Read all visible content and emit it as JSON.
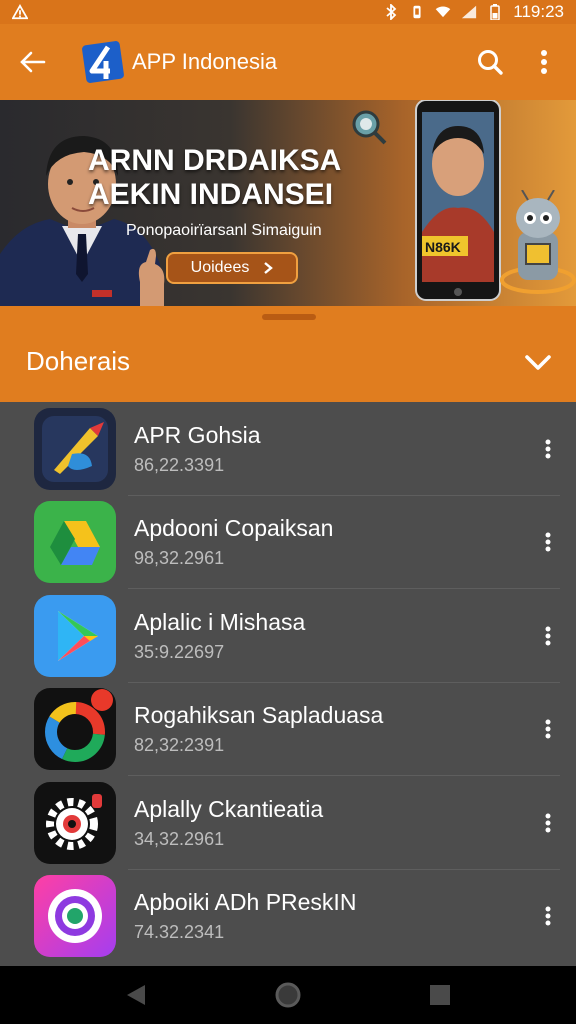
{
  "status_bar": {
    "time": "119:23"
  },
  "app_bar": {
    "title": "APP Indonesia"
  },
  "banner": {
    "headline_line1": "ARNN DRDAIKSA",
    "headline_line2": "AEKIN INDANSEI",
    "subtitle": "Ponopaoirïarsanl Simaiguin",
    "cta_label": "Uoidees",
    "phone_badge": "N86K"
  },
  "section": {
    "title": "Doherais"
  },
  "apps": [
    {
      "name": "APR Gohsia",
      "meta": "86,22.3391"
    },
    {
      "name": "Apdooni Copaiksan",
      "meta": "98,32.2961"
    },
    {
      "name": "Aplalic i Mishasa",
      "meta": "35:9.22697"
    },
    {
      "name": "Rogahiksan Sapladuasa",
      "meta": "82,32:2391"
    },
    {
      "name": "Aplally Ckantieatia",
      "meta": "34,32.2961"
    },
    {
      "name": "Apboiki ADh PReskIN",
      "meta": "74.32.2341"
    }
  ],
  "colors": {
    "accent": "#e07d1f",
    "list_bg": "#4d4d4d"
  }
}
